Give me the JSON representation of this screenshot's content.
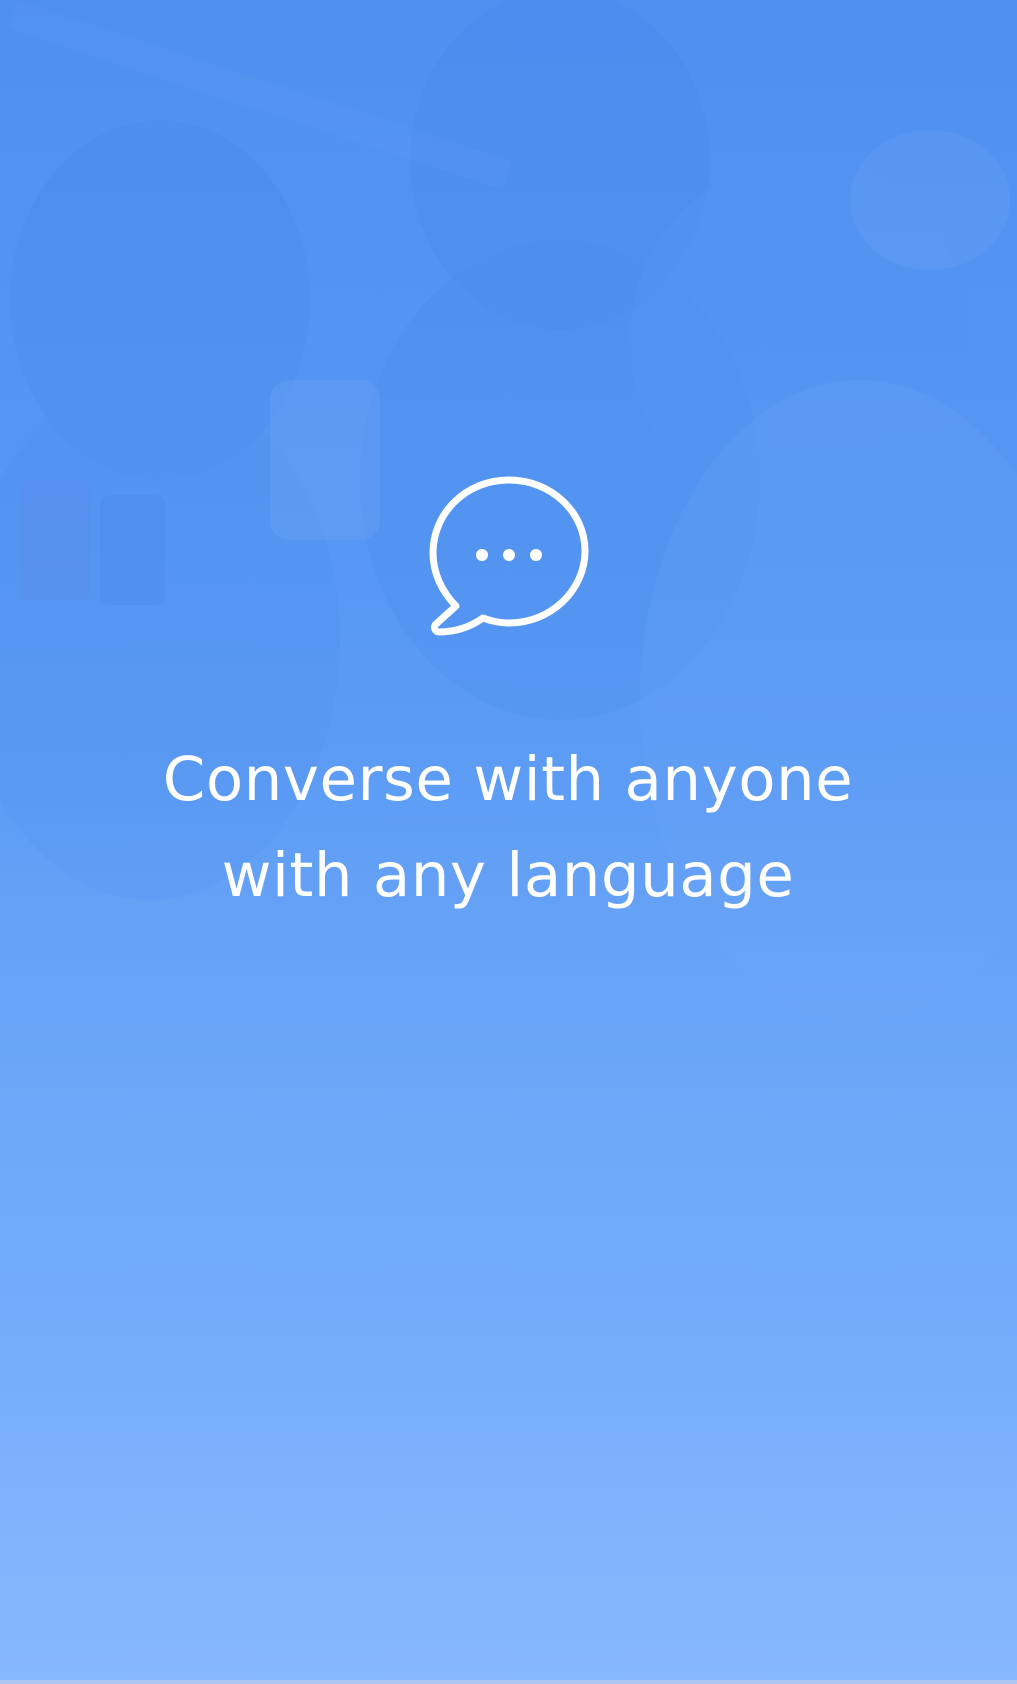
{
  "onboarding": {
    "icon": "chat-bubble-ellipsis-icon",
    "headline_line1": "Converse with anyone",
    "headline_line2": "with any language"
  },
  "colors": {
    "background_top": "#4f8ff0",
    "background_bottom": "#87b8fd",
    "text": "#ffffff"
  }
}
